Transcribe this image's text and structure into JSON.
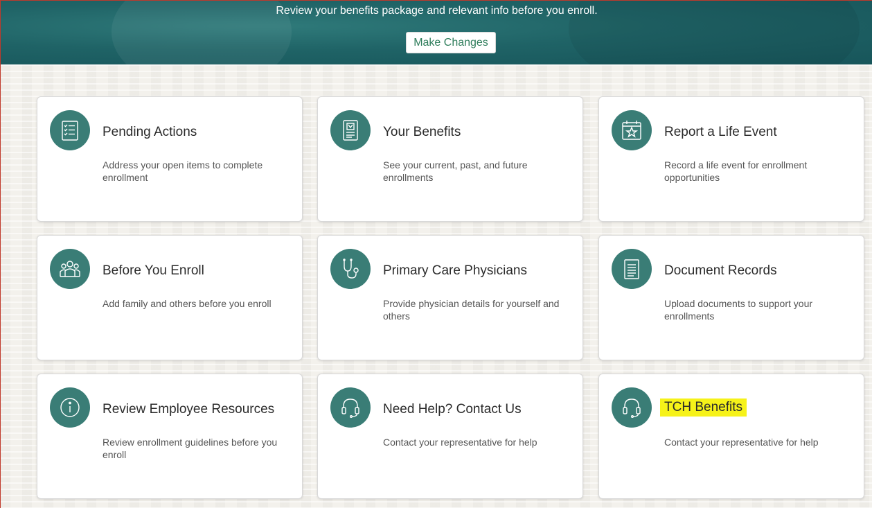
{
  "banner": {
    "text": "Review your benefits package and relevant info before you enroll.",
    "button_label": "Make Changes"
  },
  "colors": {
    "banner_teal": "#1f6366",
    "icon_teal": "#3a7d76",
    "button_text_green": "#2e7d5b",
    "highlight_yellow": "#f6f219"
  },
  "cards": [
    {
      "title": "Pending Actions",
      "description": "Address your open items to complete enrollment",
      "icon": "checklist-icon"
    },
    {
      "title": "Your Benefits",
      "description": "See your current, past, and future enrollments",
      "icon": "id-badge-icon"
    },
    {
      "title": "Report a Life Event",
      "description": "Record a life event for enrollment opportunities",
      "icon": "calendar-star-icon"
    },
    {
      "title": "Before You Enroll",
      "description": "Add family and others before you enroll",
      "icon": "group-icon"
    },
    {
      "title": "Primary Care Physicians",
      "description": "Provide physician details for yourself and others",
      "icon": "stethoscope-icon"
    },
    {
      "title": "Document Records",
      "description": "Upload documents to support your enrollments",
      "icon": "document-icon"
    },
    {
      "title": "Review Employee Resources",
      "description": "Review enrollment guidelines before you enroll",
      "icon": "info-icon"
    },
    {
      "title": "Need Help? Contact Us",
      "description": "Contact your representative for help",
      "icon": "headset-icon"
    },
    {
      "title": "TCH Benefits",
      "description": "Contact your representative for help",
      "icon": "headset-icon",
      "highlighted": true
    }
  ]
}
